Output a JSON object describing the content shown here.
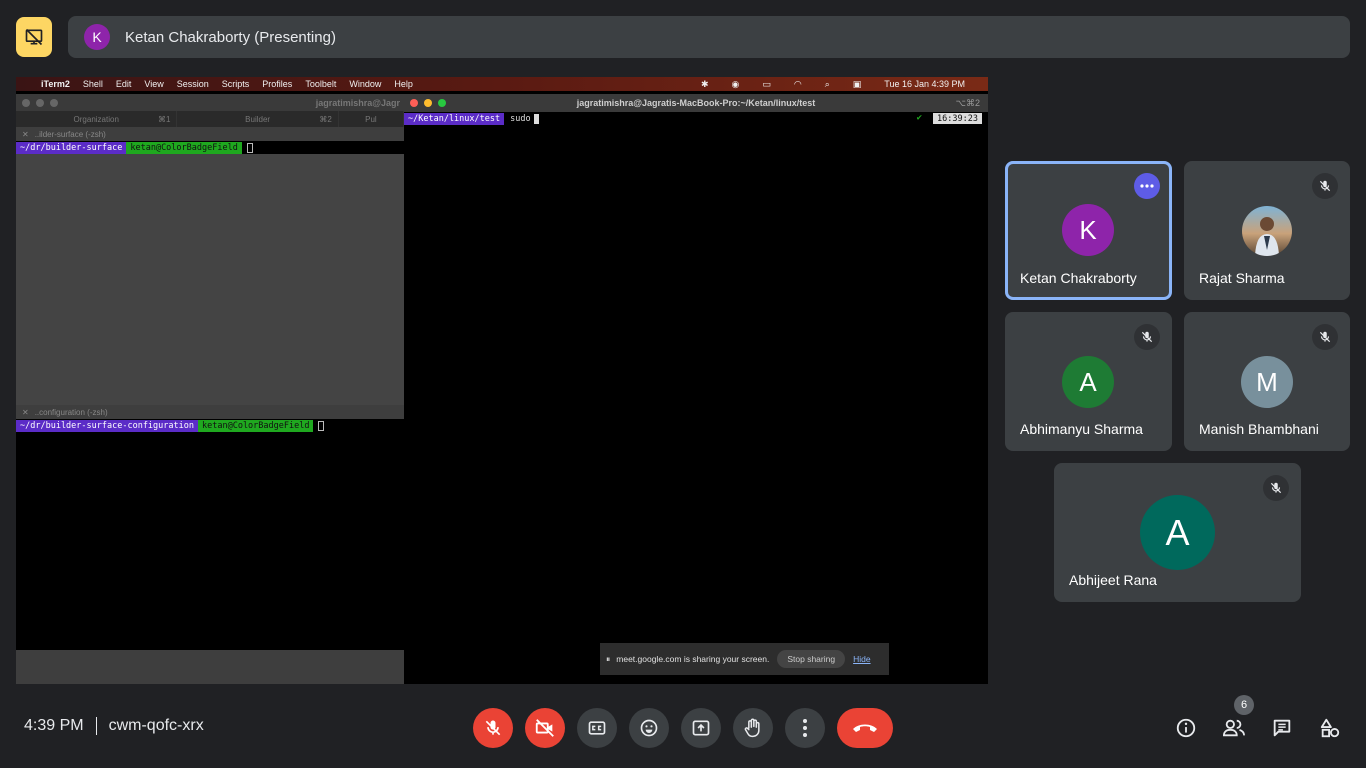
{
  "top": {
    "presenter_initial": "K",
    "presenter_label": "Ketan Chakraborty (Presenting)"
  },
  "screen": {
    "mac_menu": [
      "iTerm2",
      "Shell",
      "Edit",
      "View",
      "Session",
      "Scripts",
      "Profiles",
      "Toolbelt",
      "Window",
      "Help"
    ],
    "mac_datetime": "Tue 16 Jan  4:39 PM",
    "left_window_title": "jagratimishra@Jagr",
    "left_tabs": [
      "Organization",
      "Builder",
      "Pul"
    ],
    "left_tab_shortcuts": [
      "⌘1",
      "⌘2"
    ],
    "pane_top_label": "..ilder-surface (-zsh)",
    "pane_top_dir": "~/dr/builder-surface",
    "pane_top_branch": "ketan@ColorBadgeField",
    "pane_bottom_label": "..configuration (-zsh)",
    "pane_bottom_dir": "~/dr/builder-surface-configuration",
    "pane_bottom_branch": "ketan@ColorBadgeField",
    "right_window_title": "jagratimishra@Jagratis-MacBook-Pro:~/Ketan/linux/test",
    "right_shortcut": "⌥⌘2",
    "right_dir": "~/Ketan/linux/test",
    "right_command": "sudo",
    "right_clock": "16:39:23",
    "share_notice": "meet.google.com is sharing your screen.",
    "stop_sharing": "Stop sharing",
    "hide": "Hide"
  },
  "participants": [
    {
      "name": "Ketan Chakraborty",
      "initial": "K",
      "color": "#8e24aa",
      "active": true
    },
    {
      "name": "Rajat Sharma",
      "initial": "",
      "color": "#5b7a99",
      "muted": true
    },
    {
      "name": "Abhimanyu Sharma",
      "initial": "A",
      "color": "#1e7b34",
      "muted": true
    },
    {
      "name": "Manish Bhambhani",
      "initial": "M",
      "color": "#78909c",
      "muted": true
    },
    {
      "name": "Abhijeet Rana",
      "initial": "A",
      "color": "#00695c",
      "muted": true
    }
  ],
  "bottom": {
    "time": "4:39 PM",
    "meeting_code": "cwm-qofc-xrx",
    "people_count": "6"
  },
  "colors": {
    "background": "#202124",
    "tile": "#3c4043",
    "danger": "#ea4335",
    "present_yellow": "#fdd663",
    "active_outline": "#8ab4f8"
  }
}
